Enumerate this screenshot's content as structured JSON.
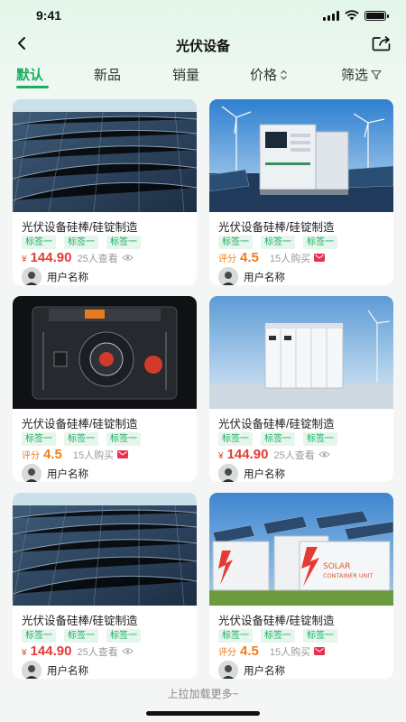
{
  "status": {
    "time": "9:41"
  },
  "nav": {
    "title": "光伏设备",
    "back_icon": "chevron-left-icon",
    "share_icon": "share-icon"
  },
  "tabs": [
    {
      "label": "默认",
      "active": true
    },
    {
      "label": "新品",
      "active": false
    },
    {
      "label": "销量",
      "active": false
    },
    {
      "label": "价格",
      "active": false,
      "icon": "sort-icon"
    },
    {
      "label": "筛选",
      "active": false,
      "icon": "filter-icon"
    }
  ],
  "colors": {
    "accent": "#1aae63",
    "price": "#e53b35",
    "score": "#f07e1b",
    "tag_bg": "#e6f6ec"
  },
  "products": [
    {
      "title": "光伏设备硅棒/硅锭制造",
      "tags": [
        "标签一",
        "标签一",
        "标签一"
      ],
      "kind": "price",
      "currency": "¥",
      "price": "144.90",
      "meta": "25人查看",
      "meta_icon": "eye-icon",
      "user": "用户名称",
      "image": "solar-panels-roof"
    },
    {
      "title": "光伏设备硅棒/硅锭制造",
      "tags": [
        "标签一",
        "标签一",
        "标签一"
      ],
      "kind": "score",
      "score_label": "评分",
      "score": "4.5",
      "meta": "15人购买",
      "meta_icon": "mail-icon",
      "user": "用户名称",
      "image": "battery-cabinet-wind"
    },
    {
      "title": "光伏设备硅棒/硅锭制造",
      "tags": [
        "标签一",
        "标签一",
        "标签一"
      ],
      "kind": "score",
      "score_label": "评分",
      "score": "4.5",
      "meta": "15人购买",
      "meta_icon": "mail-icon",
      "user": "用户名称",
      "image": "inverter-device"
    },
    {
      "title": "光伏设备硅棒/硅锭制造",
      "tags": [
        "标签一",
        "标签一",
        "标签一"
      ],
      "kind": "price",
      "currency": "¥",
      "price": "144.90",
      "meta": "25人查看",
      "meta_icon": "eye-icon",
      "user": "用户名称",
      "image": "energy-storage-cabinet"
    },
    {
      "title": "光伏设备硅棒/硅锭制造",
      "tags": [
        "标签一",
        "标签一",
        "标签一"
      ],
      "kind": "price",
      "currency": "¥",
      "price": "144.90",
      "meta": "25人查看",
      "meta_icon": "eye-icon",
      "user": "用户名称",
      "image": "solar-panels-roof"
    },
    {
      "title": "光伏设备硅棒/硅锭制造",
      "tags": [
        "标签一",
        "标签一",
        "标签一"
      ],
      "kind": "score",
      "score_label": "评分",
      "score": "4.5",
      "meta": "15人购买",
      "meta_icon": "mail-icon",
      "user": "用户名称",
      "image": "solar-container-unit",
      "image_text": [
        "SOLAR",
        "CONTAINER UNIT"
      ]
    }
  ],
  "footer": {
    "load_more": "上拉加载更多~"
  }
}
